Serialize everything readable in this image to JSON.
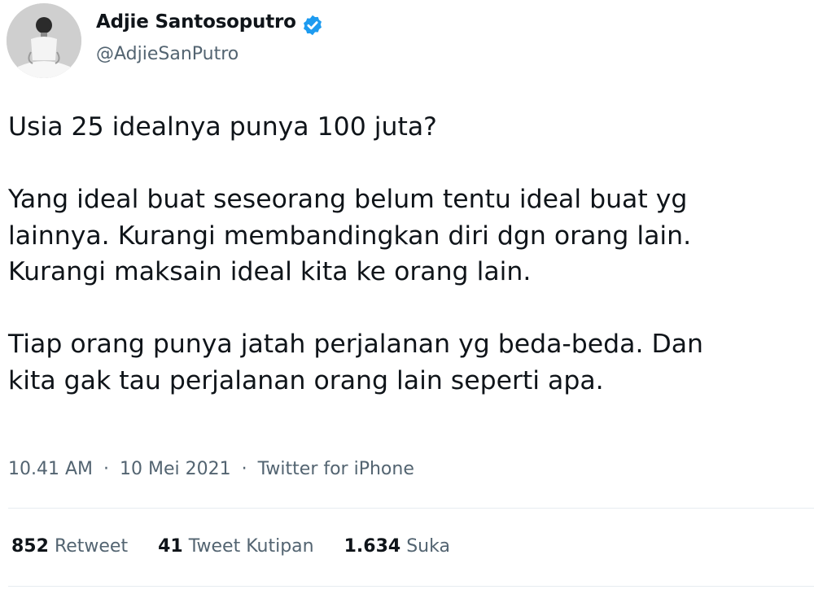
{
  "author": {
    "name": "Adjie Santosoputro",
    "handle": "@AdjieSanPutro",
    "verified": true,
    "verified_color": "#1d9bf0"
  },
  "tweet": {
    "paragraphs": [
      [
        "Usia 25 idealnya punya 100 juta?"
      ],
      [
        "Yang ideal buat seseorang belum tentu ideal buat yg",
        "lainnya. Kurangi membandingkan diri dgn orang lain.",
        "Kurangi maksain ideal kita ke orang lain."
      ],
      [
        "Tiap orang punya jatah perjalanan yg beda-beda. Dan",
        "kita gak tau perjalanan orang lain seperti apa."
      ]
    ]
  },
  "meta": {
    "time": "10.41 AM",
    "date": "10 Mei 2021",
    "source": "Twitter for iPhone",
    "separator": "·"
  },
  "stats": {
    "retweets": {
      "count": "852",
      "label": "Retweet"
    },
    "quotes": {
      "count": "41",
      "label": "Tweet Kutipan"
    },
    "likes": {
      "count": "1.634",
      "label": "Suka"
    }
  }
}
